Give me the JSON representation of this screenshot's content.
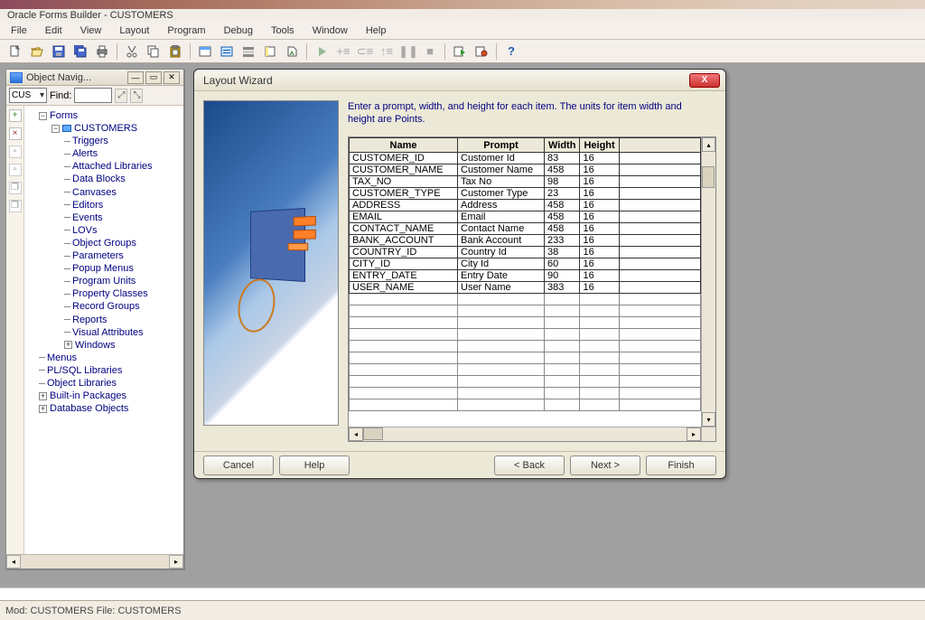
{
  "app_title": "Oracle Forms Builder - CUSTOMERS",
  "menu": [
    "File",
    "Edit",
    "View",
    "Layout",
    "Program",
    "Debug",
    "Tools",
    "Window",
    "Help"
  ],
  "navigator": {
    "title": "Object Navig...",
    "combo": "CUS",
    "find_label": "Find:",
    "tree": {
      "root": "Forms",
      "module": "CUSTOMERS",
      "children": [
        "Triggers",
        "Alerts",
        "Attached Libraries",
        "Data Blocks",
        "Canvases",
        "Editors",
        "Events",
        "LOVs",
        "Object Groups",
        "Parameters",
        "Popup Menus",
        "Program Units",
        "Property Classes",
        "Record Groups",
        "Reports",
        "Visual Attributes",
        "Windows"
      ],
      "siblings": [
        "Menus",
        "PL/SQL Libraries",
        "Object Libraries",
        "Built-in Packages",
        "Database Objects"
      ]
    }
  },
  "wizard": {
    "title": "Layout Wizard",
    "instruction": "Enter a prompt, width, and height for each item. The units for item width and height are Points.",
    "columns": {
      "name": "Name",
      "prompt": "Prompt",
      "width": "Width",
      "height": "Height"
    },
    "rows": [
      {
        "name": "CUSTOMER_ID",
        "prompt": "Customer Id",
        "width": "83",
        "height": "16"
      },
      {
        "name": "CUSTOMER_NAME",
        "prompt": "Customer Name",
        "width": "458",
        "height": "16"
      },
      {
        "name": "TAX_NO",
        "prompt": "Tax No",
        "width": "98",
        "height": "16"
      },
      {
        "name": "CUSTOMER_TYPE",
        "prompt": "Customer Type",
        "width": "23",
        "height": "16"
      },
      {
        "name": "ADDRESS",
        "prompt": "Address",
        "width": "458",
        "height": "16"
      },
      {
        "name": "EMAIL",
        "prompt": "Email",
        "width": "458",
        "height": "16"
      },
      {
        "name": "CONTACT_NAME",
        "prompt": "Contact Name",
        "width": "458",
        "height": "16"
      },
      {
        "name": "BANK_ACCOUNT",
        "prompt": "Bank Account",
        "width": "233",
        "height": "16"
      },
      {
        "name": "COUNTRY_ID",
        "prompt": "Country Id",
        "width": "38",
        "height": "16"
      },
      {
        "name": "CITY_ID",
        "prompt": "City Id",
        "width": "60",
        "height": "16"
      },
      {
        "name": "ENTRY_DATE",
        "prompt": "Entry Date",
        "width": "90",
        "height": "16"
      },
      {
        "name": "USER_NAME",
        "prompt": "User Name",
        "width": "383",
        "height": "16"
      }
    ],
    "buttons": {
      "cancel": "Cancel",
      "help": "Help",
      "back": "< Back",
      "next": "Next >",
      "finish": "Finish"
    }
  },
  "status": "Mod: CUSTOMERS File: CUSTOMERS"
}
